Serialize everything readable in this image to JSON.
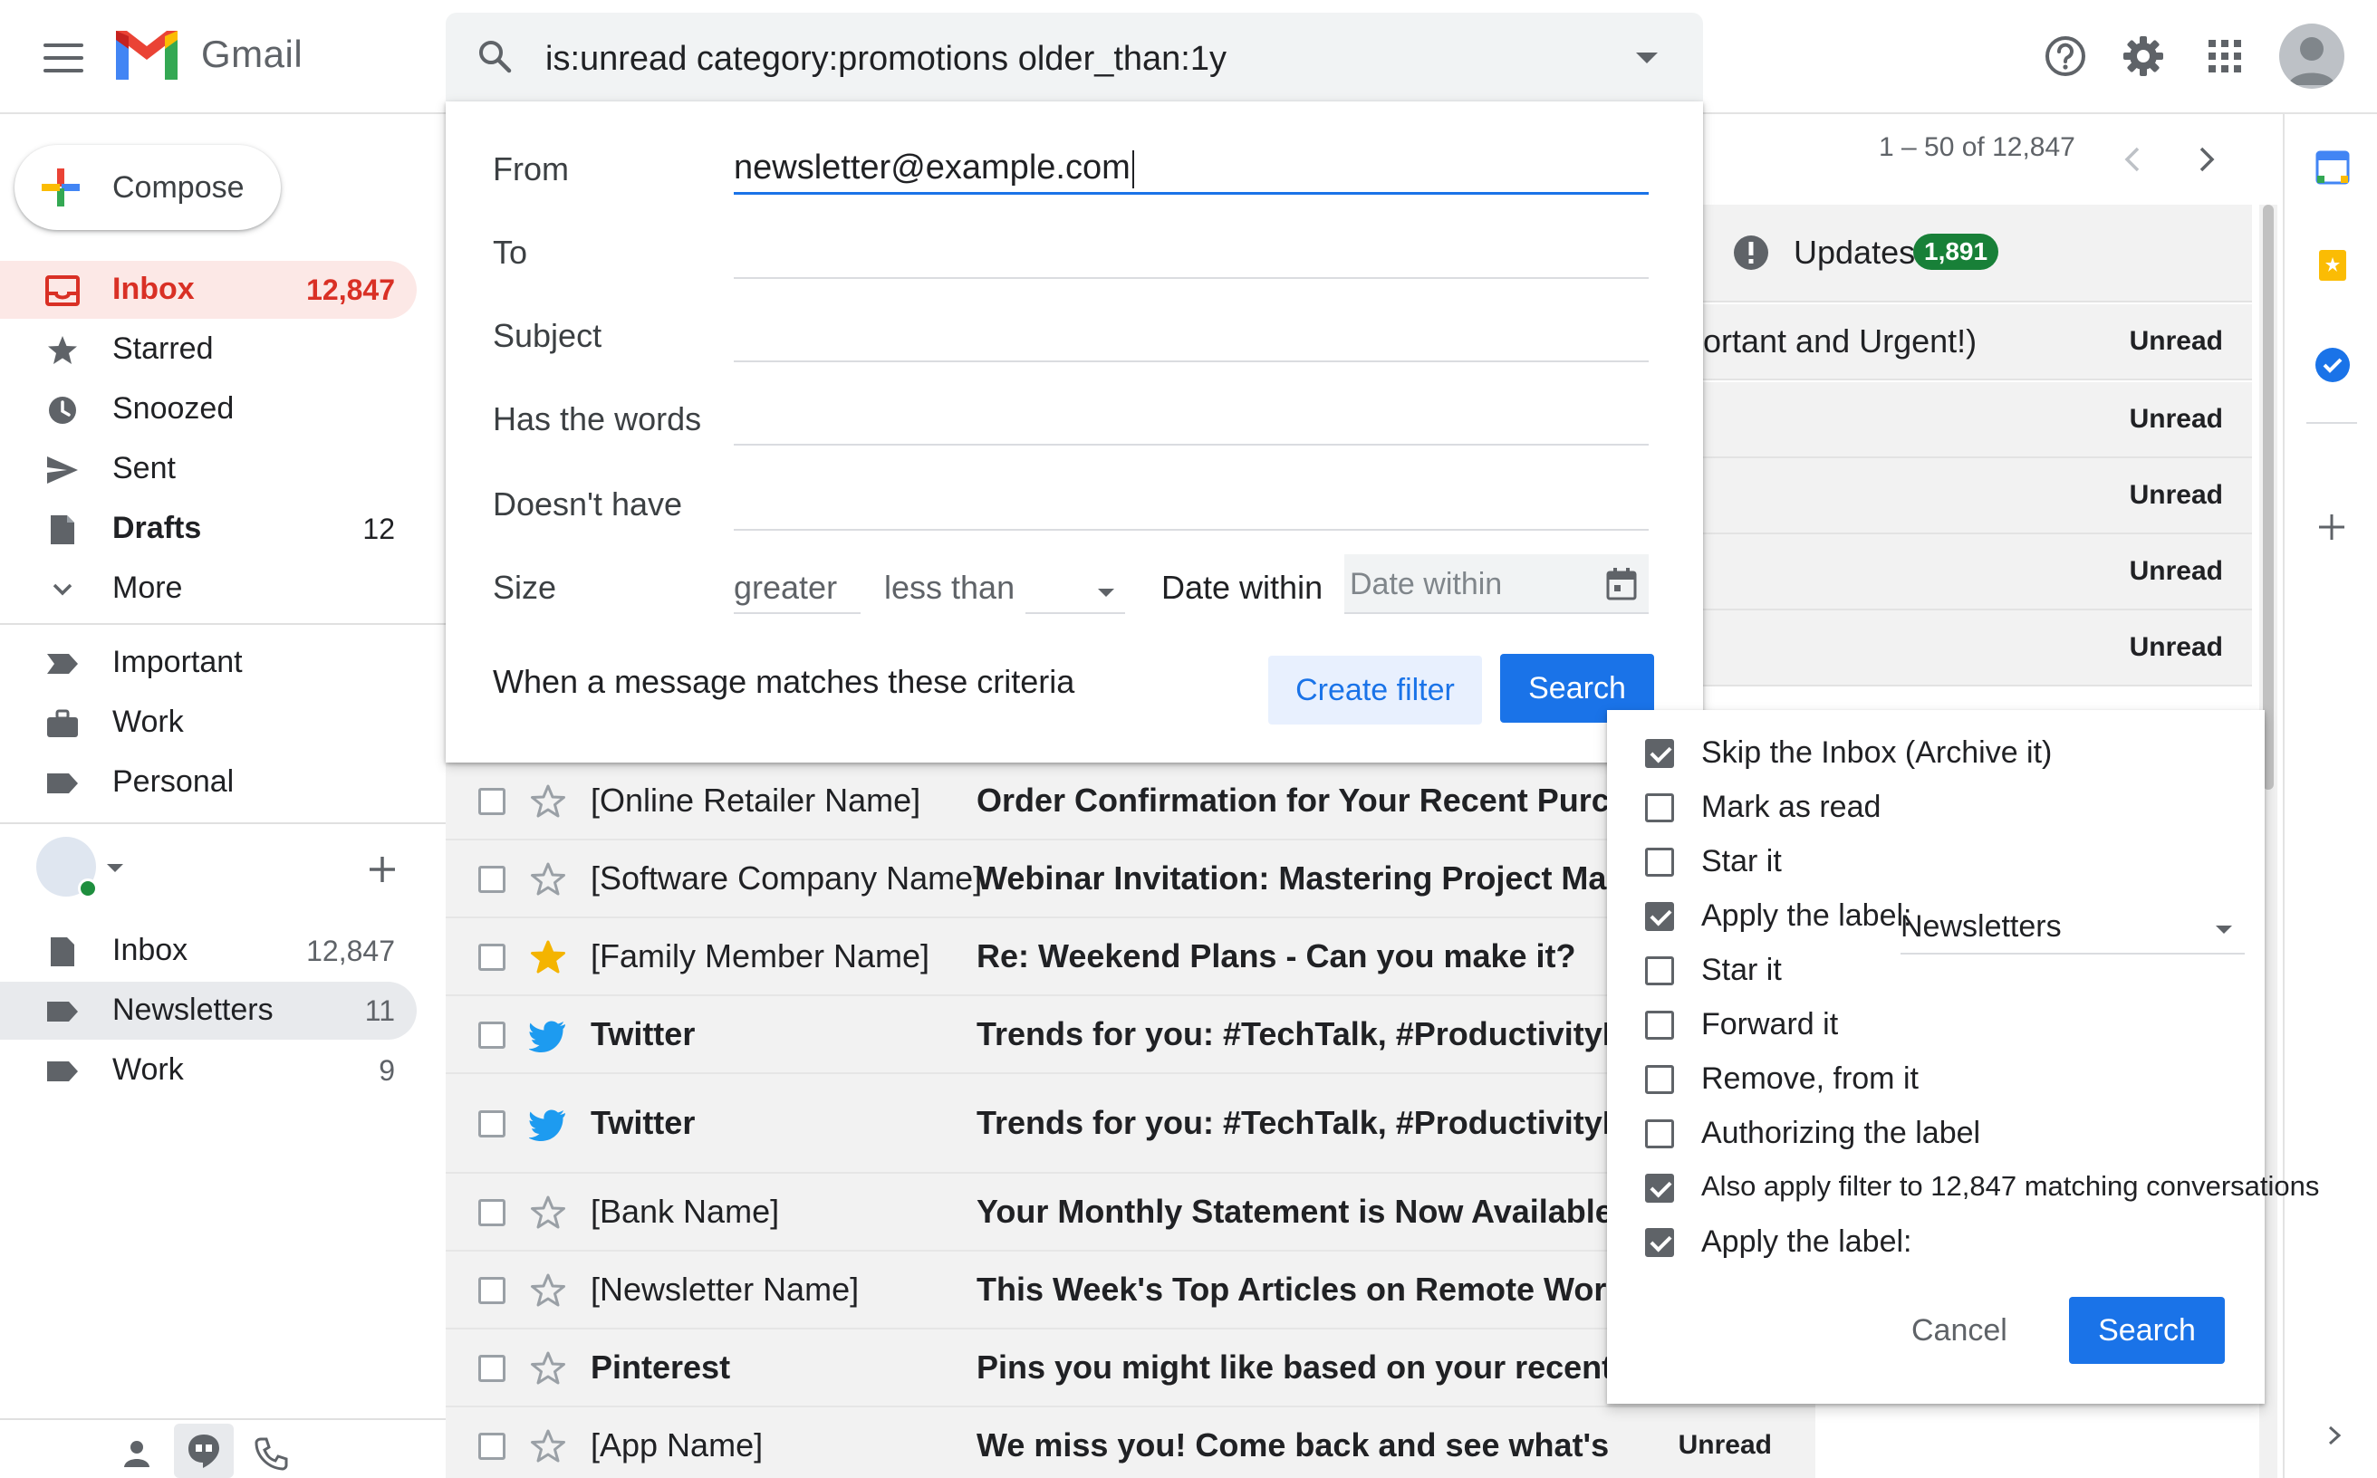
{
  "header": {
    "brand": "Gmail",
    "search_query": "is:unread category:promotions older_than:1y"
  },
  "compose": {
    "label": "Compose"
  },
  "nav": [
    {
      "label": "Inbox",
      "count": "12,847"
    },
    {
      "label": "Starred",
      "count": ""
    },
    {
      "label": "Snoozed",
      "count": ""
    },
    {
      "label": "Sent",
      "count": ""
    },
    {
      "label": "Drafts",
      "count": "12"
    },
    {
      "label": "More",
      "count": ""
    }
  ],
  "labels": [
    {
      "label": "Important"
    },
    {
      "label": "Work"
    },
    {
      "label": "Personal"
    }
  ],
  "hangouts_labels": [
    {
      "label": "Inbox",
      "count": "12,847"
    },
    {
      "label": "Newsletters",
      "count": "11"
    },
    {
      "label": "Work",
      "count": "9"
    }
  ],
  "pagination": {
    "range": "1 – 50 of 12,847"
  },
  "category_tab": {
    "label": "Updates",
    "count": "1,891"
  },
  "background_rows": [
    {
      "text": "ortant and Urgent!)",
      "badge": "Unread"
    },
    {
      "text": "",
      "badge": "Unread"
    },
    {
      "text": "",
      "badge": "Unread"
    },
    {
      "text": "",
      "badge": "Unread"
    },
    {
      "text": "",
      "badge": "Unread"
    }
  ],
  "search_panel": {
    "from_label": "From",
    "from_value": "newsletter@example.com",
    "to_label": "To",
    "subject_label": "Subject",
    "has_words_label": "Has the words",
    "doesnt_have_label": "Doesn't have",
    "size_label": "Size",
    "size_op1": "greater",
    "size_op2": "less than",
    "date_within_label": "Date within",
    "date_within_placeholder": "Date within",
    "criteria_text": "When a message matches these criteria",
    "create_filter": "Create filter",
    "search": "Search"
  },
  "emails": [
    {
      "sender": "[Online Retailer Name]",
      "subject": "Order Confirmation for Your Recent Purchase",
      "starred": false,
      "icon": "star",
      "badge": "",
      "sender_bold": false
    },
    {
      "sender": "[Software Company Name]",
      "subject": "Webinar Invitation: Mastering Project Manager",
      "starred": false,
      "icon": "star",
      "badge": "",
      "sender_bold": false
    },
    {
      "sender": "[Family Member Name]",
      "subject": "Re: Weekend Plans - Can you make it?",
      "starred": true,
      "icon": "star",
      "badge": "",
      "sender_bold": false
    },
    {
      "sender": "Twitter",
      "subject": "Trends for you: #TechTalk, #ProductivityHacks",
      "starred": false,
      "icon": "twitter-bird",
      "badge": "",
      "sender_bold": true
    },
    {
      "sender": "Twitter",
      "subject": "Trends for you: #TechTalk, #ProductivityHacks",
      "starred": false,
      "icon": "twitter-bird",
      "badge": "",
      "sender_bold": true
    },
    {
      "sender": "[Bank Name]",
      "subject": "Your Monthly Statement is Now Available",
      "starred": false,
      "icon": "star",
      "badge": "",
      "sender_bold": false
    },
    {
      "sender": "[Newsletter Name]",
      "subject": "This Week's Top Articles on Remote Work",
      "starred": false,
      "icon": "star",
      "badge": "",
      "sender_bold": false
    },
    {
      "sender": "Pinterest",
      "subject": "Pins you might like based on your recent searc",
      "starred": false,
      "icon": "star",
      "badge": "",
      "sender_bold": true
    },
    {
      "sender": "[App Name]",
      "subject": "We miss you! Come back and see what's new.",
      "starred": false,
      "icon": "star",
      "badge": "Unread",
      "sender_bold": false
    }
  ],
  "filter_actions": {
    "options": [
      {
        "label": "Skip the Inbox (Archive it)",
        "checked": true
      },
      {
        "label": "Mark as read",
        "checked": false
      },
      {
        "label": "Star it",
        "checked": false
      },
      {
        "label": "Apply the label:",
        "checked": true
      },
      {
        "label": "Star it",
        "checked": false
      },
      {
        "label": "Forward it",
        "checked": false
      },
      {
        "label": "Remove, from it",
        "checked": false
      },
      {
        "label": "Authorizing the label",
        "checked": false
      },
      {
        "label": "Also apply filter to 12,847 matching conversations",
        "checked": true
      },
      {
        "label": "Apply the label:",
        "checked": true
      }
    ],
    "label_select_value": "Newsletters",
    "cancel": "Cancel",
    "search": "Search"
  },
  "colors": {
    "accent": "#1a73e8",
    "inbox_red": "#d93025",
    "updates_badge": "#188038"
  }
}
